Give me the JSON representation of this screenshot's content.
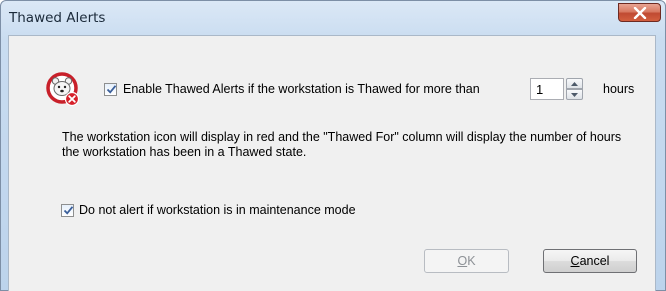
{
  "window": {
    "title": "Thawed Alerts",
    "close_label": "Close"
  },
  "enable_alert": {
    "checked": true,
    "label": "Enable Thawed Alerts if the workstation is Thawed for more than",
    "hours_value": "1",
    "hours_unit": "hours"
  },
  "description": "The workstation icon will display in red and the \"Thawed For\" column will display the number of hours the workstation has been in a Thawed state.",
  "maintenance": {
    "checked": true,
    "label": "Do not alert if workstation is in maintenance mode"
  },
  "buttons": {
    "ok_mnemonic": "O",
    "ok_rest": "K",
    "ok_enabled": false,
    "cancel_mnemonic": "C",
    "cancel_rest": "ancel"
  },
  "icons": {
    "app_icon": "thawed-alert-bear-icon",
    "close_icon": "close-x-icon",
    "spin_up": "chevron-up-icon",
    "spin_down": "chevron-down-icon",
    "checkmark": "checkmark-icon"
  },
  "colors": {
    "close_button": "#c9523a",
    "alert_badge": "#d6202a",
    "icon_ring": "#c8202a",
    "client_background": "#f0f0f0",
    "checkmark": "#3b5f9a"
  }
}
